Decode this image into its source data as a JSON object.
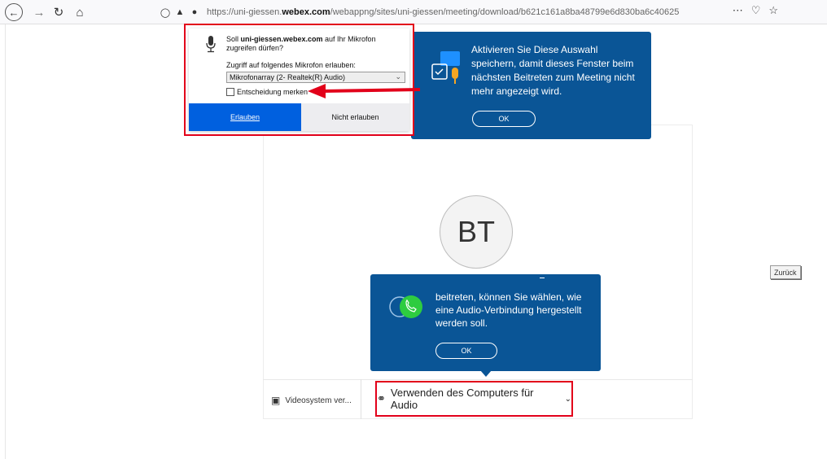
{
  "browser": {
    "url_prefix": "https://uni-giessen.",
    "url_domain": "webex.com",
    "url_path": "/webappng/sites/uni-giessen/meeting/download/b621c161a8ba48799e6d830ba6c40625",
    "more_icon": "⋯"
  },
  "permission_popup": {
    "prompt_prefix": "Soll ",
    "prompt_domain": "uni-giessen.webex.com",
    "prompt_suffix": " auf Ihr Mikrofon zugreifen dürfen?",
    "select_label": "Zugriff auf folgendes Mikrofon erlauben:",
    "selected_device": "Mikrofonarray (2- Realtek(R) Audio)",
    "remember_label": "Entscheidung merken",
    "allow_label": "Erlauben",
    "deny_label": "Nicht erlauben"
  },
  "tooltip_top": {
    "text": "Aktivieren Sie Diese Auswahl speichern, damit dieses Fenster beim nächsten Beitreten zum Meeting nicht mehr angezeigt wird.",
    "ok_label": "OK"
  },
  "tooltip_bottom": {
    "text": "beitreten, können Sie wählen, wie eine Audio-Verbindung hergestellt werden soll.",
    "ok_label": "OK"
  },
  "meeting": {
    "avatar_initials": "BT",
    "video_system_label": "Videosystem ver...",
    "audio_label": "Verwenden des Computers für Audio"
  },
  "back_link": "Zurück",
  "colors": {
    "tooltip_bg": "#0a5596",
    "highlight_red": "#e2001a",
    "allow_blue": "#0060df"
  }
}
